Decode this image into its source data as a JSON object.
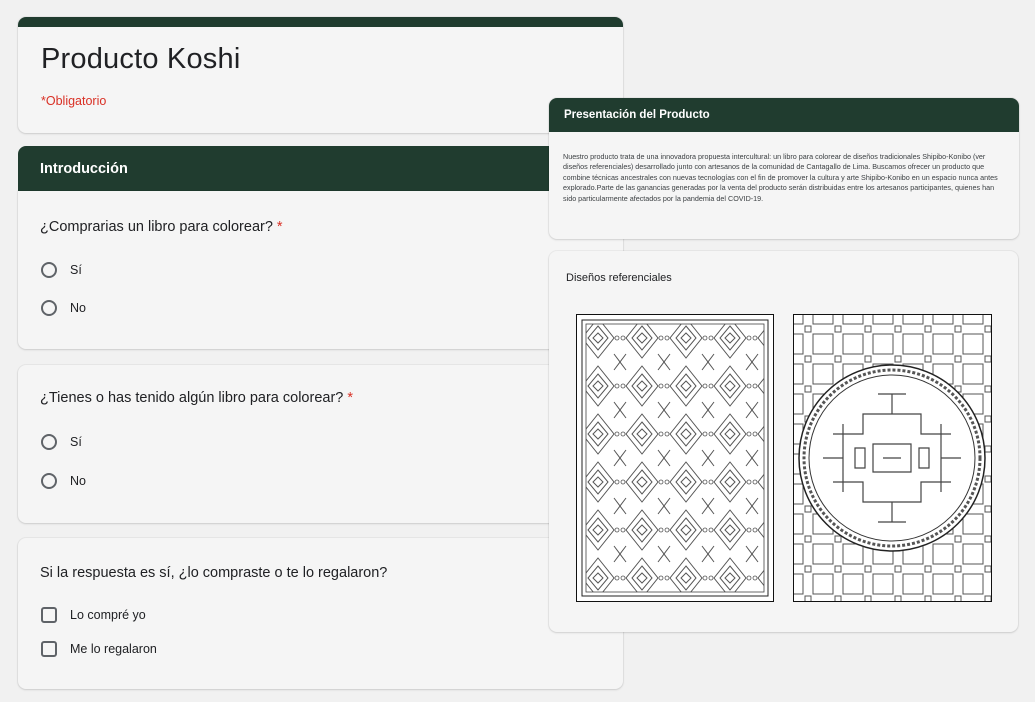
{
  "form": {
    "title": "Producto Koshi",
    "required_note": "*Obligatorio"
  },
  "section": {
    "title": "Introducción"
  },
  "questions": [
    {
      "text": "¿Comprarias un libro para colorear?",
      "required_mark": "*",
      "type": "radio",
      "options": [
        "Sí",
        "No"
      ]
    },
    {
      "text": "¿Tienes o has tenido algún libro para colorear?",
      "required_mark": "*",
      "type": "radio",
      "options": [
        "Sí",
        "No"
      ]
    },
    {
      "text": "Si la respuesta es sí, ¿lo compraste o te lo regalaron?",
      "type": "checkbox",
      "options": [
        "Lo compré yo",
        "Me lo regalaron"
      ]
    }
  ],
  "presentation": {
    "title": "Presentación del Producto",
    "body": "Nuestro producto trata de una innovadora propuesta intercultural: un libro para colorear de diseños tradicionales Shipibo-Konibo (ver diseños referenciales) desarrollado junto con artesanos de la comunidad de Cantagallo de Lima. Buscamos ofrecer un producto que combine técnicas ancestrales con nuevas tecnologías con el fin de promover la cultura y arte Shipibo-Konibo en un espacio nunca antes explorado.Parte de las ganancias generadas por la venta del producto serán distribuidas entre los artesanos participantes, quienes han sido particularmente afectados por la pandemia del COVID-19."
  },
  "designs": {
    "title": "Diseños referenciales",
    "images": [
      "shipibo-pattern-rhombus",
      "shipibo-pattern-circle"
    ]
  },
  "colors": {
    "header_bg": "#203c2f",
    "required": "#d93025",
    "card_bg": "#f5f5f5",
    "page_bg": "#f1f1f1"
  }
}
